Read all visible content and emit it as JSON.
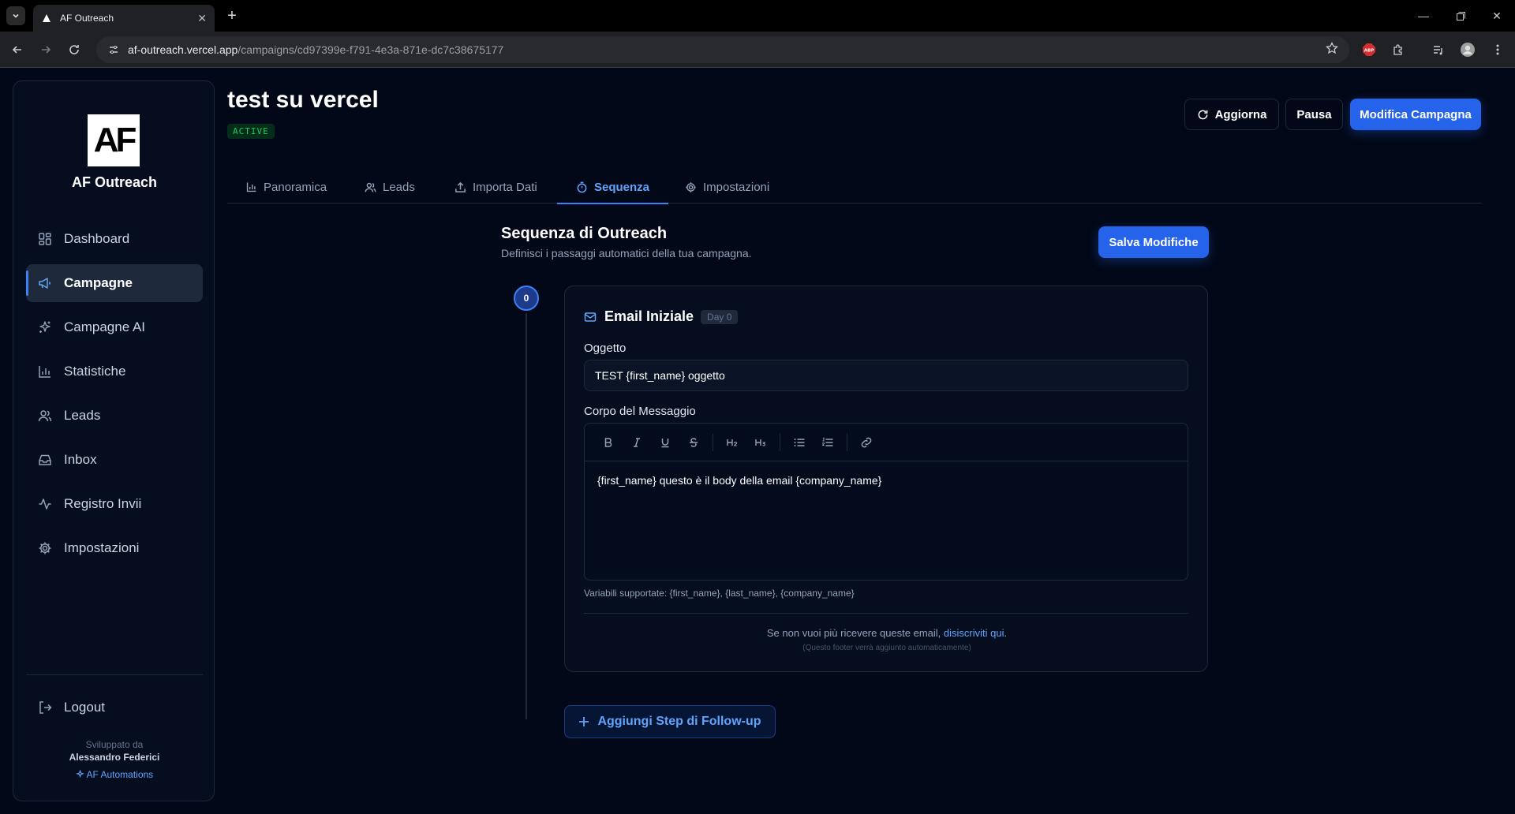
{
  "browser": {
    "tab_title": "AF Outreach",
    "url_host": "af-outreach.vercel.app",
    "url_path": "/campaigns/cd97399e-f791-4e3a-871e-dc7c38675177"
  },
  "sidebar": {
    "logo_text": "AF",
    "brand": "AF Outreach",
    "items": [
      {
        "label": "Dashboard",
        "icon": "grid-icon",
        "active": false
      },
      {
        "label": "Campagne",
        "icon": "megaphone-icon",
        "active": true
      },
      {
        "label": "Campagne AI",
        "icon": "sparkles-icon",
        "active": false
      },
      {
        "label": "Statistiche",
        "icon": "bar-chart-icon",
        "active": false
      },
      {
        "label": "Leads",
        "icon": "users-icon",
        "active": false
      },
      {
        "label": "Inbox",
        "icon": "inbox-icon",
        "active": false
      },
      {
        "label": "Registro Invii",
        "icon": "activity-icon",
        "active": false
      },
      {
        "label": "Impostazioni",
        "icon": "gear-icon",
        "active": false
      }
    ],
    "logout": "Logout",
    "credit_line1": "Sviluppato da",
    "credit_line2": "Alessandro Federici",
    "credit_line3": "AF Automations"
  },
  "header": {
    "title": "test su vercel",
    "status": "ACTIVE",
    "refresh_label": "Aggiorna",
    "pause_label": "Pausa",
    "edit_label": "Modifica Campagna"
  },
  "tabs": [
    {
      "label": "Panoramica",
      "icon": "bar-chart-icon"
    },
    {
      "label": "Leads",
      "icon": "users-icon"
    },
    {
      "label": "Importa Dati",
      "icon": "upload-icon"
    },
    {
      "label": "Sequenza",
      "icon": "timer-icon",
      "active": true
    },
    {
      "label": "Impostazioni",
      "icon": "gear-icon"
    }
  ],
  "sequence": {
    "title": "Sequenza di Outreach",
    "subtitle": "Definisci i passaggi automatici della tua campagna.",
    "save_label": "Salva Modifiche",
    "add_step_label": "Aggiungi Step di Follow-up"
  },
  "step": {
    "number": "0",
    "title": "Email Iniziale",
    "day": "Day 0",
    "subject_label": "Oggetto",
    "subject_value": "TEST {first_name}  oggetto",
    "body_label": "Corpo del Messaggio",
    "body_value": "{first_name} questo è il body della email {company_name}",
    "vars_text": "Variabili supportate: {first_name}, {last_name}, {company_name}",
    "footer_text": "Se non vuoi più ricevere queste email, ",
    "footer_link": "disiscriviti qui",
    "footer_end": ".",
    "footer_note": "(Questo footer verrà aggiunto automaticamente)"
  },
  "colors": {
    "background": "#020817",
    "accent": "#2563eb",
    "active_status": "#22c55e"
  }
}
